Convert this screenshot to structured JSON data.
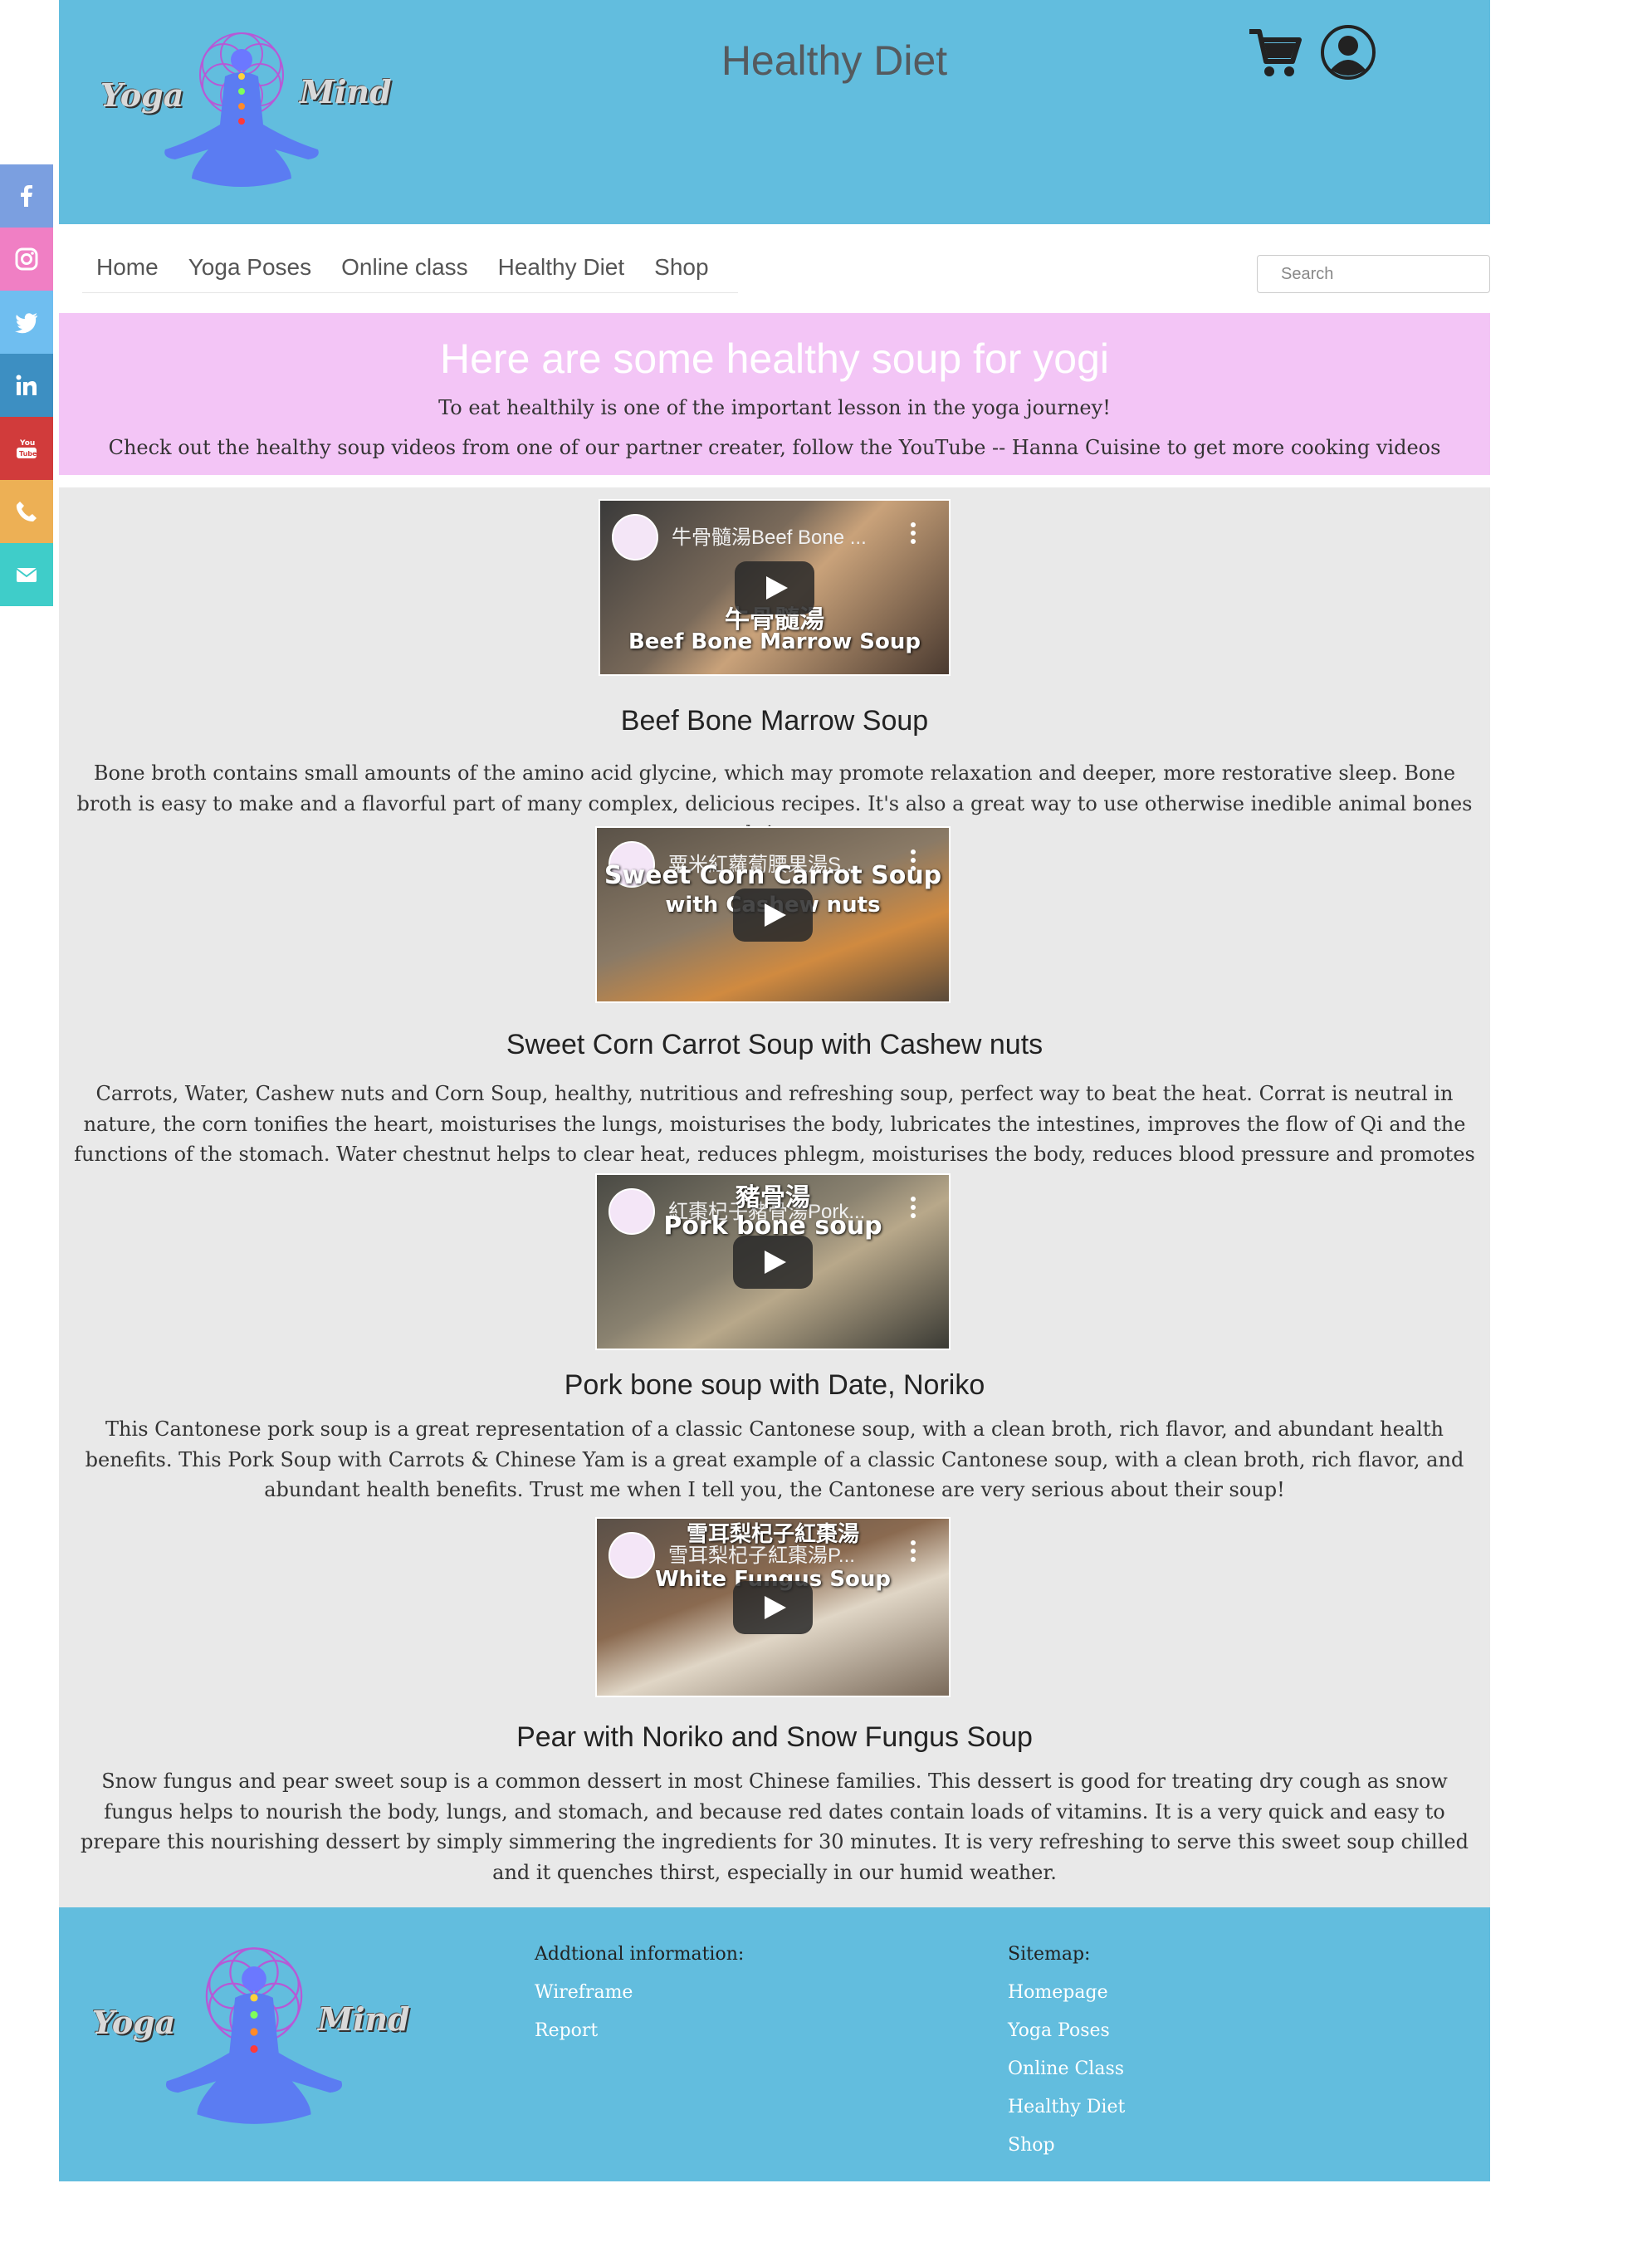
{
  "header": {
    "logo_left_word": "Yoga",
    "logo_right_word": "Mind",
    "site_title": "Healthy Diet"
  },
  "nav": {
    "items": [
      "Home",
      "Yoga Poses",
      "Online class",
      "Healthy Diet",
      "Shop"
    ],
    "search_placeholder": "Search"
  },
  "social": [
    {
      "icon": "facebook-icon",
      "color": "#7b9fe0"
    },
    {
      "icon": "instagram-icon",
      "color": "#f07fc4"
    },
    {
      "icon": "twitter-icon",
      "color": "#6fbef0"
    },
    {
      "icon": "linkedin-icon",
      "color": "#3d8fc2"
    },
    {
      "icon": "youtube-icon",
      "color": "#d13b3b"
    },
    {
      "icon": "phone-icon",
      "color": "#edb055"
    },
    {
      "icon": "email-icon",
      "color": "#3fcdc9"
    }
  ],
  "banner": {
    "heading": "Here are some healthy soup for yogi",
    "line1": "To eat healthily is one of the important lesson in the yoga journey!",
    "line2": "Check out the healthy soup videos from one of our partner creater, follow the YouTube -- Hanna Cuisine to get more cooking videos"
  },
  "soups": [
    {
      "video_title": "牛骨髓湯Beef Bone ...",
      "caption_top": "牛骨髓湯",
      "caption_bottom": "Beef Bone Marrow Soup",
      "title": "Beef Bone Marrow Soup",
      "description": "Bone broth contains small amounts of the amino acid glycine, which may promote relaxation and deeper, more restorative sleep. Bone broth is easy to make and a flavorful part of many complex, delicious recipes. It's also a great way to use otherwise inedible animal bones and tissues."
    },
    {
      "video_title": "粟米紅蘿蔔腰果湯S...",
      "caption_top": "Sweet Corn Carrot Soup",
      "caption_bottom": "with Cashew nuts",
      "title": "Sweet Corn Carrot Soup with Cashew nuts",
      "description": "Carrots, Water, Cashew nuts and Corn Soup, healthy, nutritious and refreshing soup, perfect way to beat the heat. Corrat is neutral in nature, the corn tonifies the heart, moisturises the lungs, moisturises the body, lubricates the intestines, improves the flow of Qi and the functions of the stomach. Water chestnut helps to clear heat, reduces phlegm, moisturises the body, reduces blood pressure and promotes diuresis."
    },
    {
      "video_title": "紅棗杞子豬骨湯Pork...",
      "caption_top": "豬骨湯",
      "caption_bottom": "Pork bone soup",
      "title": "Pork bone soup with Date, Noriko",
      "description": "This Cantonese pork soup is a great representation of a classic Cantonese soup, with a clean broth, rich flavor, and abundant health benefits. This Pork Soup with Carrots & Chinese Yam is a great example of a classic Cantonese soup, with a clean broth, rich flavor, and abundant health benefits. Trust me when I tell you, the Cantonese are very serious about their soup!"
    },
    {
      "video_title": "雪耳梨杞子紅棗湯P...",
      "caption_top": "雪耳梨杞子紅棗湯",
      "caption_bottom": "White Fungus Soup",
      "title": "Pear with Noriko and Snow Fungus Soup",
      "description": "Snow fungus and pear sweet soup is a common dessert in most Chinese families. This dessert is good for treating dry cough as snow fungus helps to nourish the body, lungs, and stomach, and because red dates contain loads of vitamins. It is a very quick and easy to prepare this nourishing dessert by simply simmering the ingredients for 30 minutes. It is very refreshing to serve this sweet soup chilled and it quenches thirst, especially in our humid weather."
    }
  ],
  "footer": {
    "additional_label": "Addtional information:",
    "additional_links": [
      "Wireframe",
      "Report"
    ],
    "sitemap_label": "Sitemap:",
    "sitemap_links": [
      "Homepage",
      "Yoga Poses",
      "Online Class",
      "Healthy Diet",
      "Shop"
    ]
  },
  "colors": {
    "header_blue": "#62bdde",
    "banner_pink": "#f3c5f6",
    "content_grey": "#e9e9e9"
  }
}
